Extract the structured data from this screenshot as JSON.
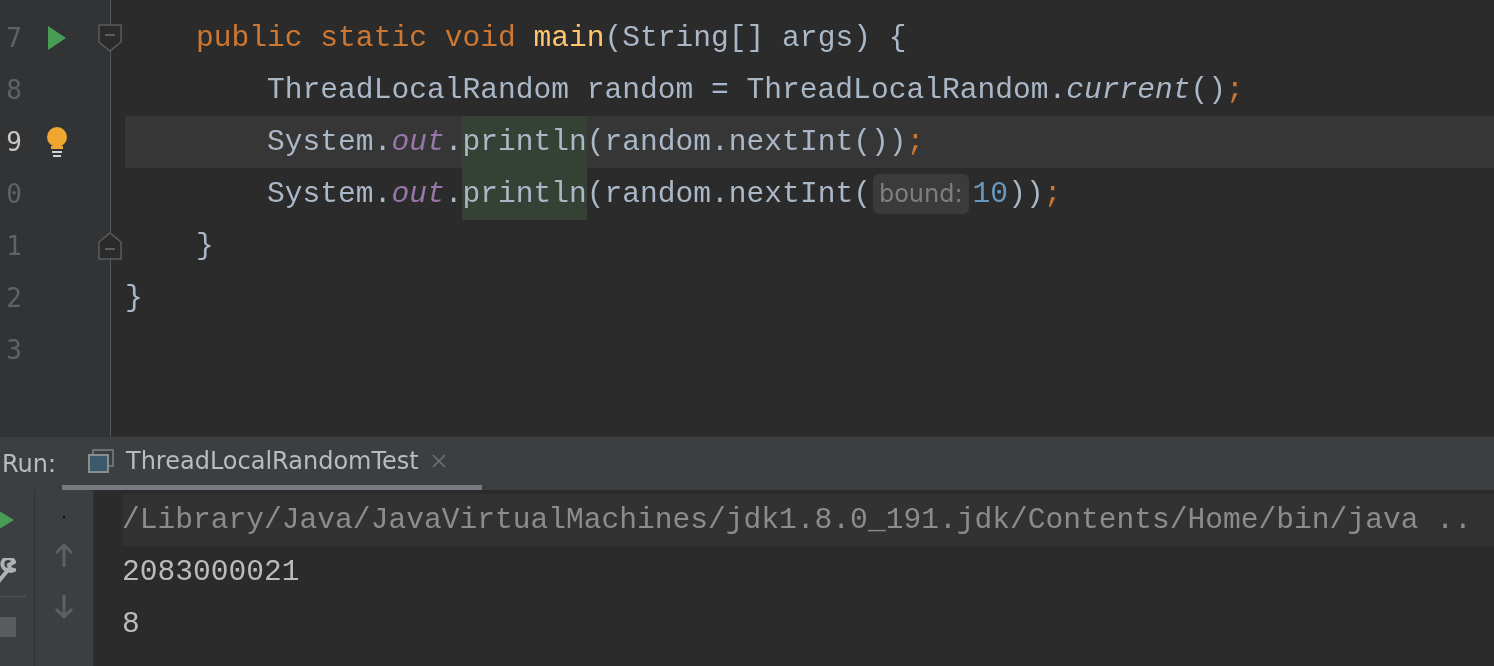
{
  "editor": {
    "lines": [
      {
        "number": "7",
        "run_marker": true,
        "fold_start": true,
        "current": false,
        "tokens": [
          {
            "t": "    public static void ",
            "kind": "keyword"
          },
          {
            "t": "main",
            "kind": "declaration"
          },
          {
            "t": "(String[] args) {",
            "kind": "plain"
          }
        ]
      },
      {
        "number": "8",
        "current": false,
        "tokens": [
          {
            "t": "        ThreadLocalRandom random = ThreadLocalRandom.",
            "kind": "plain"
          },
          {
            "t": "current",
            "kind": "italic"
          },
          {
            "t": "()",
            "kind": "plain"
          },
          {
            "t": ";",
            "kind": "keyword"
          }
        ]
      },
      {
        "number": "9",
        "bulb": true,
        "current": true,
        "tokens": [
          {
            "t": "        System.",
            "kind": "plain"
          },
          {
            "t": "out",
            "kind": "static_field"
          },
          {
            "t": ".",
            "kind": "plain"
          },
          {
            "t": "println",
            "kind": "usage"
          },
          {
            "t": "(random.nextInt())",
            "kind": "plain"
          },
          {
            "t": ";",
            "kind": "keyword"
          }
        ]
      },
      {
        "number": "0",
        "current": false,
        "tokens": [
          {
            "t": "        System.",
            "kind": "plain"
          },
          {
            "t": "out",
            "kind": "static_field"
          },
          {
            "t": ".",
            "kind": "plain"
          },
          {
            "t": "println",
            "kind": "usage"
          },
          {
            "t": "(random.nextInt(",
            "kind": "plain"
          },
          {
            "t": "bound:",
            "kind": "hint"
          },
          {
            "t": "10",
            "kind": "number"
          },
          {
            "t": "))",
            "kind": "plain"
          },
          {
            "t": ";",
            "kind": "keyword"
          }
        ]
      },
      {
        "number": "1",
        "fold_end": true,
        "current": false,
        "tokens": [
          {
            "t": "    }",
            "kind": "plain"
          }
        ]
      },
      {
        "number": "2",
        "current": false,
        "tokens": [
          {
            "t": "}",
            "kind": "plain"
          }
        ]
      },
      {
        "number": "3",
        "current": false
      }
    ]
  },
  "run_panel": {
    "label": "Run:",
    "tabs": [
      {
        "title": "ThreadLocalRandomTest",
        "selected": true
      }
    ],
    "console": [
      {
        "text": "/Library/Java/JavaVirtualMachines/jdk1.8.0_191.jdk/Contents/Home/bin/java ..",
        "kind": "command"
      },
      {
        "text": "2083000021",
        "kind": "output"
      },
      {
        "text": "8",
        "kind": "output"
      }
    ]
  }
}
